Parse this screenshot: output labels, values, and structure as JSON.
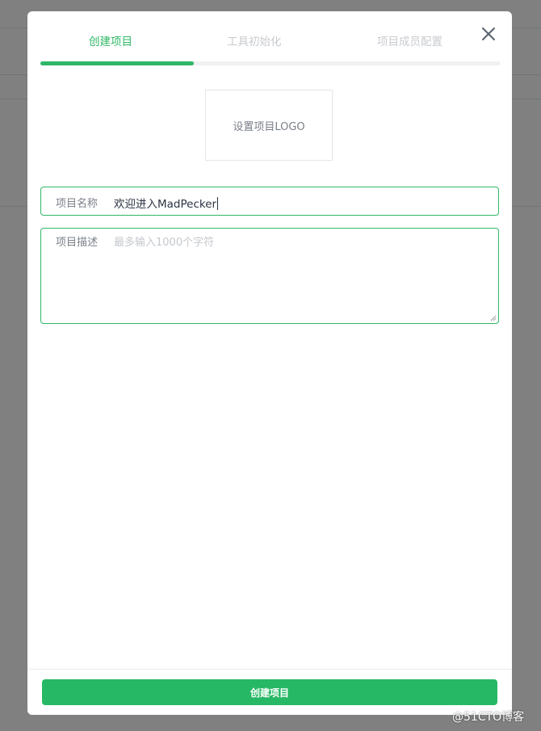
{
  "steps": [
    {
      "label": "创建项目",
      "active": true
    },
    {
      "label": "工具初始化",
      "active": false
    },
    {
      "label": "项目成员配置",
      "active": false
    }
  ],
  "progress": {
    "fraction": 0.333
  },
  "logo_upload": {
    "label": "设置项目LOGO"
  },
  "form": {
    "name": {
      "label": "项目名称",
      "value": "欢迎进入MadPecker"
    },
    "description": {
      "label": "项目描述",
      "placeholder": "最多输入1000个字符"
    }
  },
  "footer": {
    "submit_label": "创建项目"
  },
  "watermark": {
    "text": "@51CTO博客"
  },
  "colors": {
    "accent": "#2fb866",
    "button": "#27b865",
    "overlay": "rgba(0,0,0,0.48)"
  },
  "icons": {
    "close": "close-icon"
  }
}
